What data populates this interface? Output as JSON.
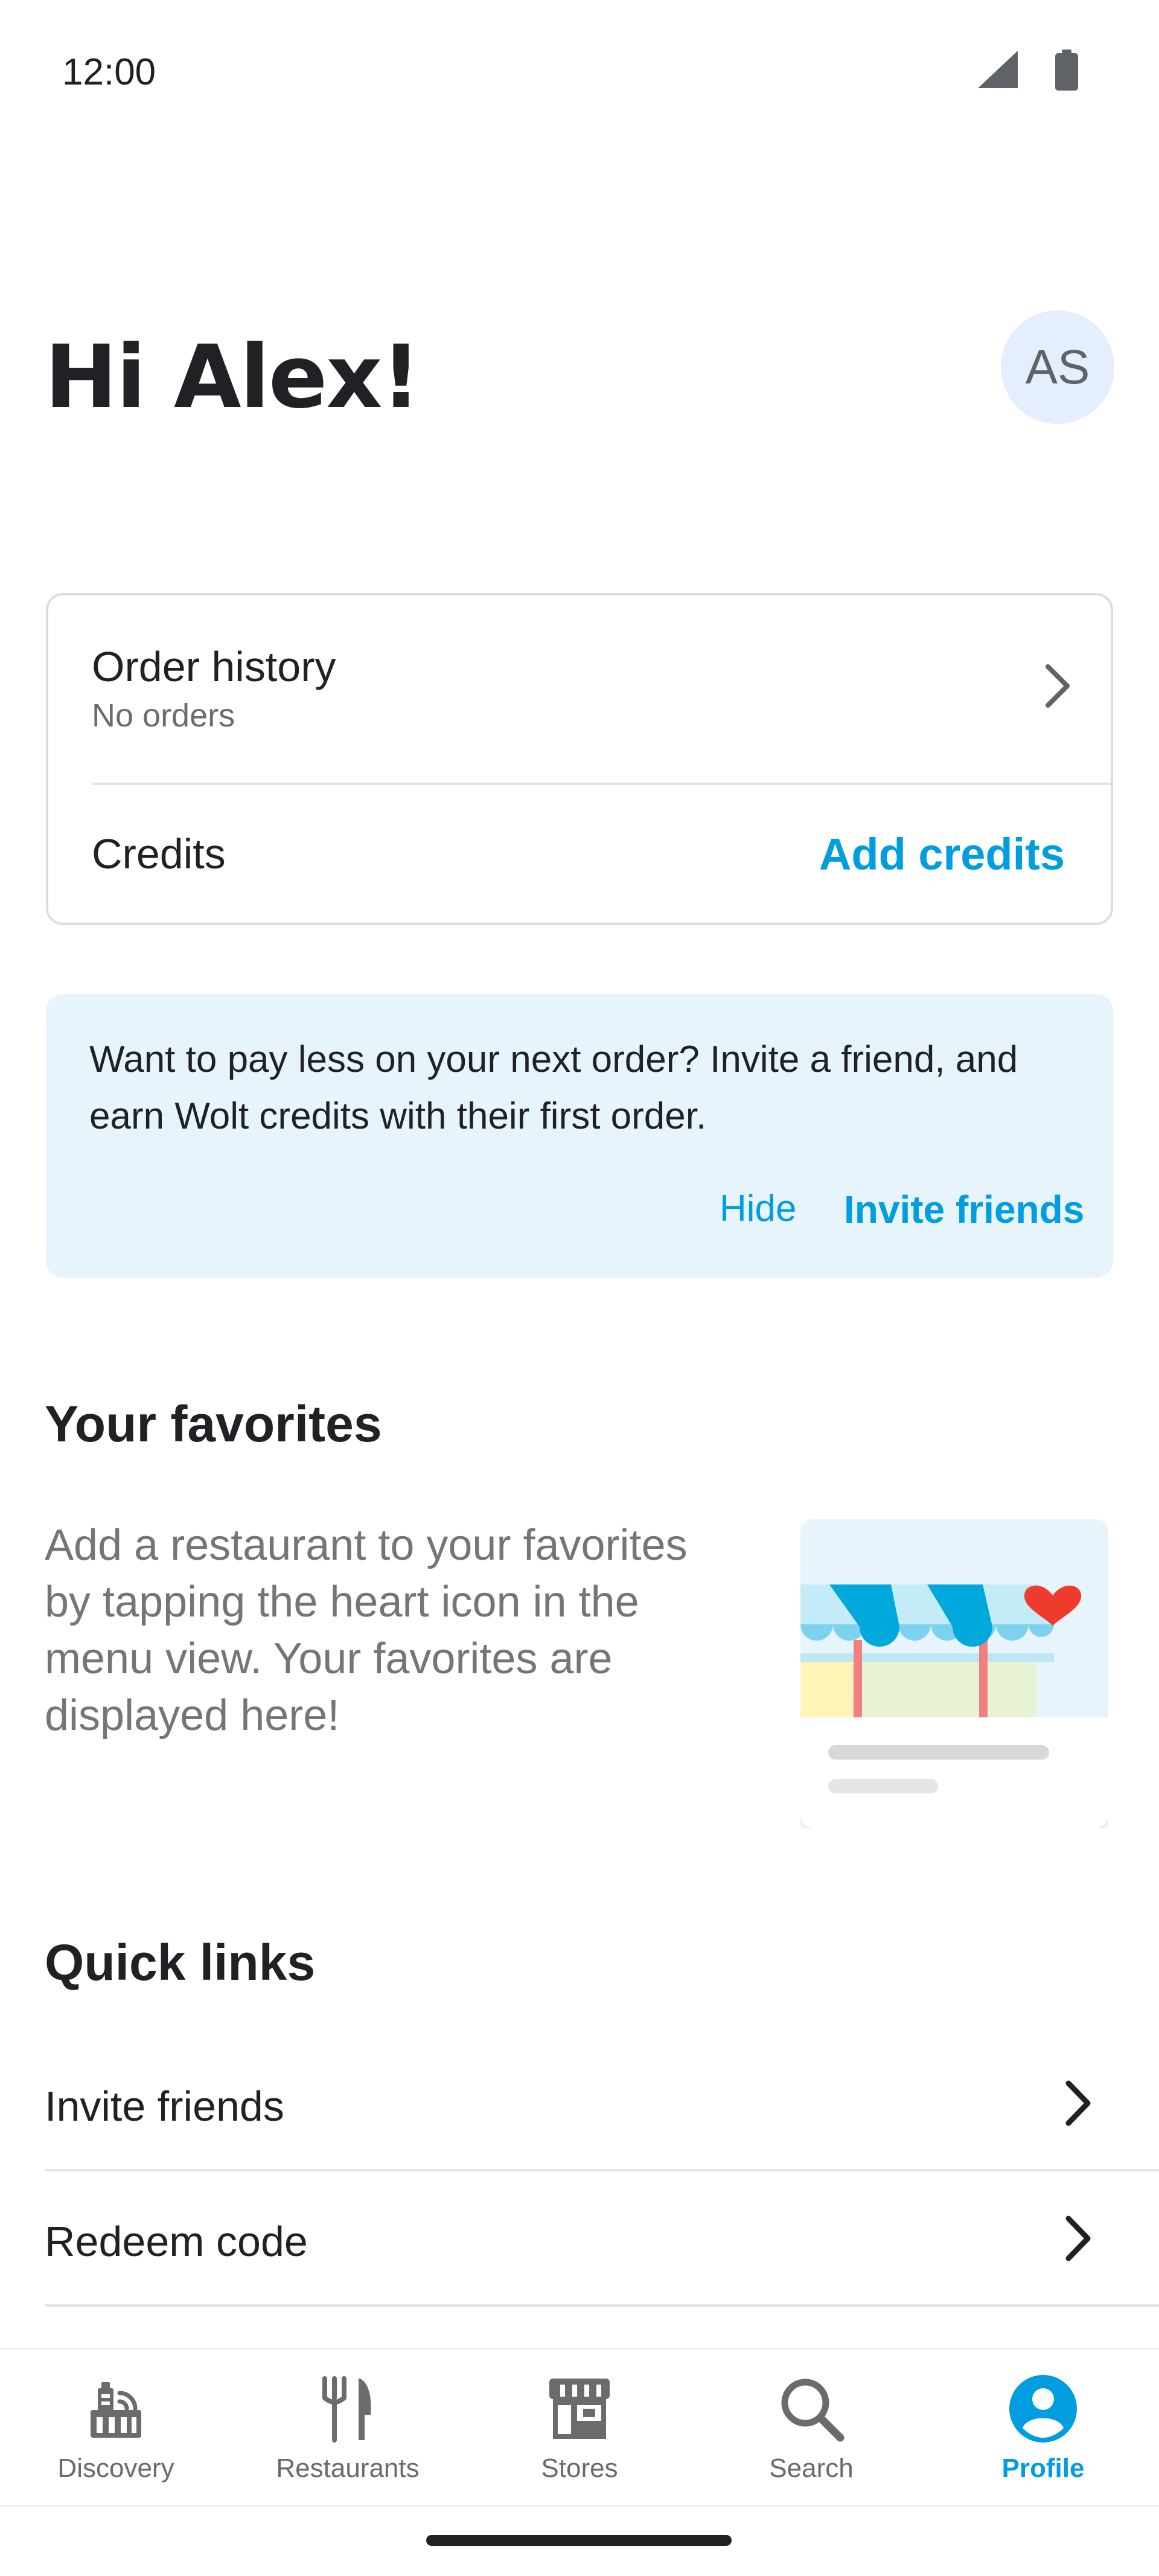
{
  "status_bar": {
    "time": "12:00"
  },
  "header": {
    "greeting": "Hi Alex!",
    "avatar_initials": "AS"
  },
  "account_card": {
    "order_history_title": "Order history",
    "order_history_subtitle": "No orders",
    "credits_label": "Credits",
    "add_credits_label": "Add credits"
  },
  "promo": {
    "text": "Want to pay less on your next order? Invite a friend, and earn Wolt credits with their first order.",
    "hide_label": "Hide",
    "invite_label": "Invite friends"
  },
  "favorites": {
    "title": "Your favorites",
    "empty_text": "Add a restaurant to your favorites by tapping the heart icon in the menu view. Your favorites are displayed here!"
  },
  "quick_links": {
    "title": "Quick links",
    "items": [
      {
        "label": "Invite friends"
      },
      {
        "label": "Redeem code"
      }
    ]
  },
  "bottom_nav": {
    "items": [
      {
        "label": "Discovery",
        "icon": "discovery-icon"
      },
      {
        "label": "Restaurants",
        "icon": "restaurants-icon"
      },
      {
        "label": "Stores",
        "icon": "stores-icon"
      },
      {
        "label": "Search",
        "icon": "search-icon"
      },
      {
        "label": "Profile",
        "icon": "profile-icon",
        "active": true
      }
    ]
  },
  "colors": {
    "accent": "#009de0",
    "promo_bg": "#e8f4fb",
    "avatar_bg": "#e5eefc",
    "text": "#202125"
  }
}
